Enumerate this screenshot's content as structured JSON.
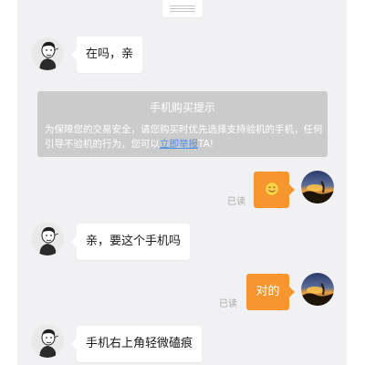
{
  "messages": [
    {
      "side": "left",
      "text": "在吗，亲"
    },
    {
      "side": "right",
      "text": "",
      "emoji": "smile-emoji",
      "read_label": "已读"
    },
    {
      "side": "left",
      "text": "亲，要这个手机吗"
    },
    {
      "side": "right",
      "text": "对的",
      "read_label": "已读"
    },
    {
      "side": "left",
      "text": "手机右上角轻微磕痕"
    }
  ],
  "notice": {
    "title": "手机购买提示",
    "body_before": "为保障您的交易安全，请您购买时优先选择支持验机的手机，任何引导不验机的行为，您可以",
    "link_text": "立即举报",
    "body_after": "TA!"
  },
  "colors": {
    "chat_bg": "#f1f1f3",
    "outgoing_bubble": "#f7962f",
    "incoming_bubble": "#ffffff",
    "notice_bg": "#cbcbcb",
    "link": "#4a90e2",
    "read_label": "#a8a8a8"
  },
  "icons": {
    "seller_avatar": "sketch-person-avatar",
    "buyer_avatar": "sunset-landscape-avatar",
    "emoji": "smile-emoji",
    "top_handle": "drag-handle-icon"
  }
}
